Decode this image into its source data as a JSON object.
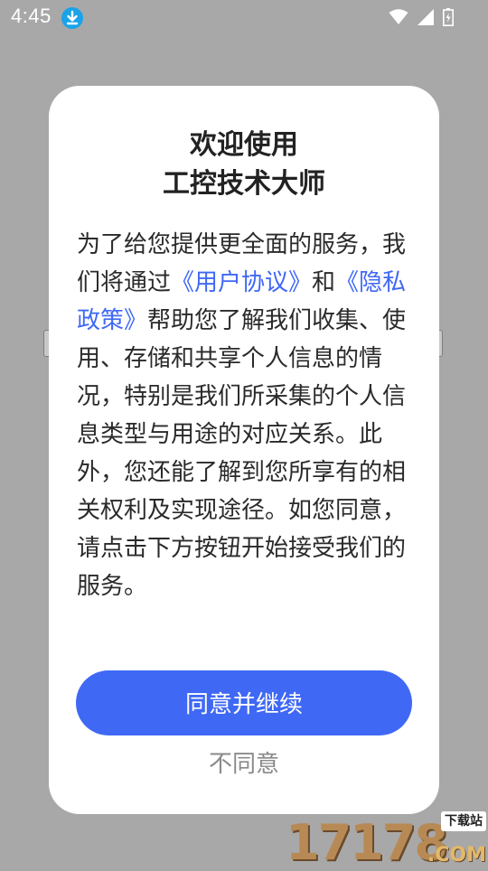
{
  "status_bar": {
    "time": "4:45",
    "icons": [
      "download-icon",
      "wifi-icon",
      "cellular-signal-icon",
      "battery-charging-icon"
    ]
  },
  "dialog": {
    "title_line_1": "欢迎使用",
    "title_line_2": "工控技术大师",
    "body": {
      "text_1": "为了给您提供更全面的服务，我们将通过",
      "user_agreement_link": "《用户协议》",
      "text_2": "和",
      "privacy_policy_link": "《隐私政策》",
      "text_3": "帮助您了解我们收集、使用、存储和共享个人信息的情况，特别是我们所采集的个人信息类型与用途的对应关系。此外，您还能了解到您所享有的相关权利及实现途径。如您同意，请点击下方按钮开始接受我们的服务。"
    },
    "agree_label": "同意并继续",
    "disagree_label": "不同意"
  },
  "watermark": {
    "number": "17178",
    "tag": "下载站",
    "domain": ".COM"
  },
  "colors": {
    "accent": "#3f68f5",
    "overlay": "#a8a8a8",
    "dialog_bg": "#ffffff",
    "text_primary": "#222222",
    "text_secondary": "#8a8a8a"
  }
}
